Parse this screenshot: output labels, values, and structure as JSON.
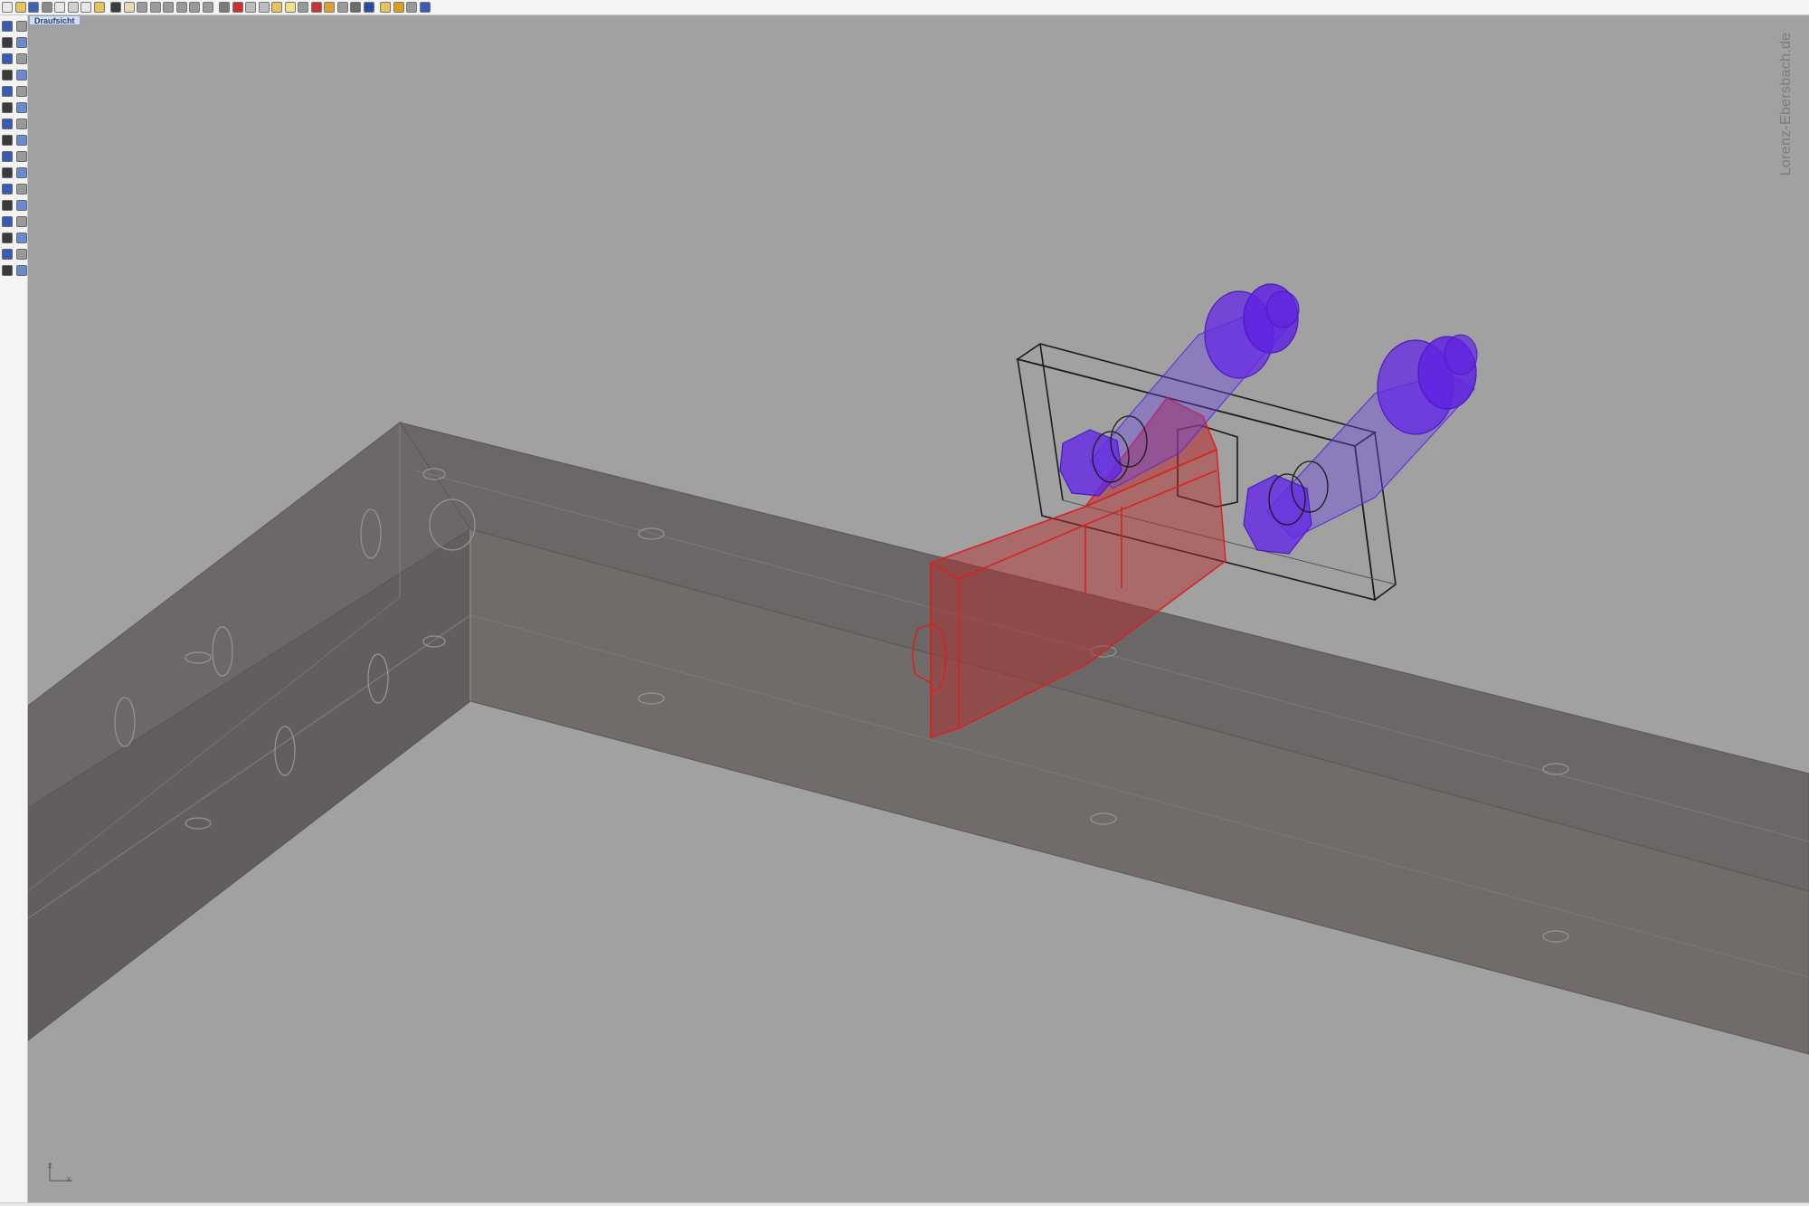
{
  "toolbar": {
    "buttons": [
      {
        "name": "new-file-icon",
        "color": "#e8e8e8"
      },
      {
        "name": "open-folder-icon",
        "color": "#e6c45a"
      },
      {
        "name": "save-icon",
        "color": "#3f63b8"
      },
      {
        "name": "print-icon",
        "color": "#8a8a8a"
      },
      {
        "name": "import-icon",
        "color": "#e8e8e8"
      },
      {
        "name": "cut-icon",
        "color": "#d0d0d0"
      },
      {
        "name": "copy-icon",
        "color": "#e8e8e8"
      },
      {
        "name": "paste-icon",
        "color": "#e6c45a"
      },
      {
        "name": "undo-icon",
        "color": "#3a3a3a"
      },
      {
        "name": "pan-hand-icon",
        "color": "#e8d7b8"
      },
      {
        "name": "rotate-view-icon",
        "color": "#9a9a9a"
      },
      {
        "name": "zoom-dynamic-icon",
        "color": "#9a9a9a"
      },
      {
        "name": "zoom-window-icon",
        "color": "#9a9a9a"
      },
      {
        "name": "zoom-extents-icon",
        "color": "#9a9a9a"
      },
      {
        "name": "zoom-selected-icon",
        "color": "#9a9a9a"
      },
      {
        "name": "undo-view-icon",
        "color": "#9a9a9a"
      },
      {
        "name": "four-viewports-icon",
        "color": "#7a7a7a"
      },
      {
        "name": "car-icon",
        "color": "#c83232"
      },
      {
        "name": "object-snap-icon",
        "color": "#bdbdbd"
      },
      {
        "name": "grid-snap-icon",
        "color": "#bdbdbd"
      },
      {
        "name": "layer-icon",
        "color": "#e6c45a"
      },
      {
        "name": "light-bulb-icon",
        "color": "#f0e28a"
      },
      {
        "name": "lock-icon",
        "color": "#9a9a9a"
      },
      {
        "name": "properties-icon",
        "color": "#c83232"
      },
      {
        "name": "color-wheel-icon",
        "color": "#e0a030"
      },
      {
        "name": "render-preview-icon",
        "color": "#9a9a9a"
      },
      {
        "name": "render-icon",
        "color": "#6c6c6c"
      },
      {
        "name": "shaded-sphere-icon",
        "color": "#2a4aa0"
      },
      {
        "name": "select-arrow-icon",
        "color": "#e6c45a"
      },
      {
        "name": "options-gear-icon",
        "color": "#d8a020"
      },
      {
        "name": "named-views-icon",
        "color": "#9a9a9a"
      },
      {
        "name": "help-icon",
        "color": "#3a5ab8"
      }
    ]
  },
  "sidebar": {
    "tools": [
      "select-arrow-icon",
      "point-icon",
      "polyline-icon",
      "control-points-icon",
      "circle-icon",
      "rectangle-icon",
      "arc-icon",
      "ellipse-icon",
      "polygon-icon",
      "curve-icon",
      "fillet-icon",
      "offset-icon",
      "plane-surface-icon",
      "extrude-icon",
      "box-solid-icon",
      "sphere-solid-icon",
      "cylinder-icon",
      "torus-icon",
      "boolean-union-icon",
      "explode-icon",
      "join-icon",
      "trim-icon",
      "split-icon",
      "move-icon",
      "copy-object-icon",
      "rotate-object-icon",
      "scale-icon",
      "mirror-icon",
      "array-icon",
      "dimension-icon",
      "text-icon",
      "hatch-icon"
    ]
  },
  "viewport": {
    "tab_label": "Draufsicht",
    "watermark": "Lorenz-Ebersbach.de",
    "axis_z_label": "z",
    "axis_x_label": "x"
  },
  "colors": {
    "background": "#a1a1a1",
    "beam_top": "#6f6a69",
    "beam_side": "#605c5c",
    "bracket_red": "#d82020",
    "bolts_violet": "#6a30e8",
    "plate_outline": "#1a1a1a"
  }
}
